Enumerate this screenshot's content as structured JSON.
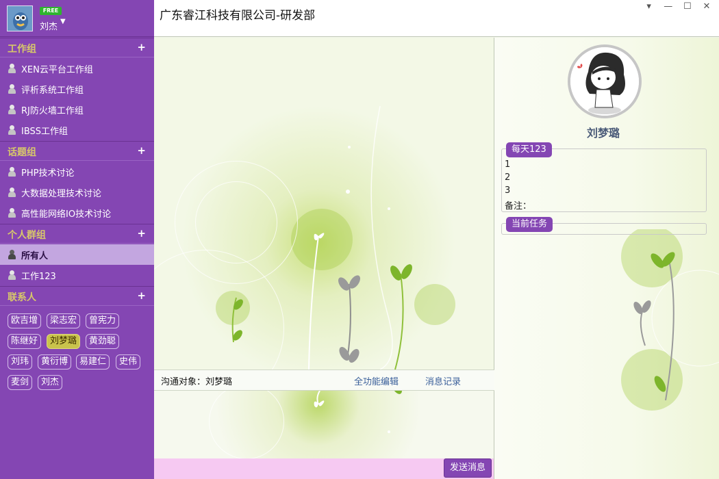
{
  "user": {
    "name": "刘杰",
    "badge": "FREE"
  },
  "groups": [
    {
      "title": "工作组",
      "items": [
        "XEN云平台工作组",
        "评析系统工作组",
        "RJ防火墙工作组",
        "IBSS工作组"
      ]
    },
    {
      "title": "话题组",
      "items": [
        "PHP技术讨论",
        "大数据处理技术讨论",
        "高性能网络IO技术讨论"
      ]
    },
    {
      "title": "个人群组",
      "items": [
        "所有人",
        "工作123"
      ],
      "selected": "所有人"
    }
  ],
  "contacts_header": "联系人",
  "contacts": [
    "欧吉增",
    "梁志宏",
    "曾宪力",
    "陈继好",
    "刘梦璐",
    "黄劲聪",
    "刘玮",
    "黄衍博",
    "易建仁",
    "史伟",
    "麦剑",
    "刘杰"
  ],
  "selected_contact": "刘梦璐",
  "window": {
    "title": "广东睿江科技有限公司-研发部",
    "controls": [
      "▾",
      "—",
      "☐",
      "✕"
    ]
  },
  "chat": {
    "target_label": "沟通对象：刘梦璐",
    "full_edit": "全功能编辑",
    "message_log": "消息记录",
    "send_button": "发送消息"
  },
  "profile": {
    "name": "刘梦璐",
    "daily": {
      "title": "每天123",
      "lines": [
        "1",
        "2",
        "3",
        "备注："
      ]
    },
    "current_task": {
      "title": "当前任务"
    }
  },
  "colors": {
    "sidebar": "#8446b3",
    "selected_item": "#c3a6e0",
    "selected_contact": "#c9c34c",
    "send_bar": "#f6c9f2",
    "link": "#3a5f9a"
  }
}
